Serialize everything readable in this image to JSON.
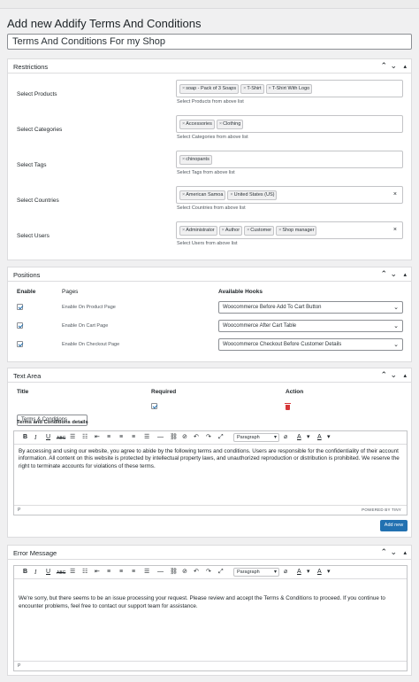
{
  "page": {
    "title": "Add new Addify Terms And Conditions",
    "name_value": "Terms And Conditions For my Shop"
  },
  "restrictions": {
    "title": "Restrictions",
    "rows": [
      {
        "label": "Select Products",
        "tags": [
          "soap - Pack of 3 Soaps",
          "T-Shirt",
          "T-Shirt With Logo"
        ],
        "helper": "Select Products from above list",
        "clear": ""
      },
      {
        "label": "Select Categories",
        "tags": [
          "Accessories",
          "Clothing"
        ],
        "helper": "Select Categories from above list",
        "clear": ""
      },
      {
        "label": "Select Tags",
        "tags": [
          "chinopants"
        ],
        "helper": "Select Tags from above list",
        "clear": ""
      },
      {
        "label": "Select Countries",
        "tags": [
          "American Samoa",
          "United States (US)"
        ],
        "helper": "Select Countries from above list",
        "clear": "×"
      },
      {
        "label": "Select Users",
        "tags": [
          "Administrator",
          "Author",
          "Customer",
          "Shop manager"
        ],
        "helper": "Select Users from above list",
        "clear": "×"
      }
    ]
  },
  "positions": {
    "title": "Positions",
    "headers": {
      "enable": "Enable",
      "pages": "Pages",
      "hooks": "Available Hooks"
    },
    "rows": [
      {
        "page": "Enable On Product Page",
        "hook": "Woocommerce Before Add To Cart Button",
        "enabled": true
      },
      {
        "page": "Enable On Cart Page",
        "hook": "Woocommerce After Cart Table",
        "enabled": true
      },
      {
        "page": "Enable On Checkout Page",
        "hook": "Woocommerce Checkout Before Customer Details",
        "enabled": true
      }
    ]
  },
  "text_area": {
    "title": "Text Area",
    "headers": {
      "title": "Title",
      "required": "Required",
      "action": "Action"
    },
    "title_value": "Terms & Conditions",
    "details_label": "Terms and Conditions details",
    "format_select": "Paragraph",
    "body": "By accessing and using our website, you agree to abide by the following terms and conditions. Users are responsible for the confidentiality of their account information. All content on this website is protected by intellectual property laws, and unauthorized reproduction or distribution is prohibited. We reserve the right to terminate accounts for violations of these terms.",
    "status_path": "P",
    "powered_by": "POWERED BY TINY",
    "add_new": "Add new"
  },
  "error_message": {
    "title": "Error Message",
    "format_select": "Paragraph",
    "body": "We're sorry, but there seems to be an issue processing your request. Please review and accept the Terms & Conditions to proceed. If you continue to encounter problems, feel free to contact our support team for assistance.",
    "status_path": "P"
  },
  "icons": {
    "collapse_up": "chevron-up-icon",
    "collapse_down": "chevron-down-icon",
    "toggle": "triangle-toggle-icon",
    "bold": "B",
    "italic": "I",
    "underline": "U",
    "strike": "ABC",
    "header_up": "⌃",
    "header_down": "⌄",
    "header_toggle": "▴"
  },
  "colors": {
    "accent": "#2271b1",
    "danger": "#d63638"
  }
}
